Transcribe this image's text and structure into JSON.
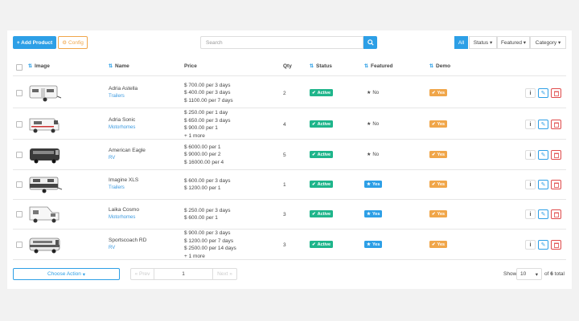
{
  "toolbar": {
    "add_product_label": "+ Add Product",
    "config_label": "Config",
    "search_placeholder": "Search",
    "filter_all": "All",
    "filter_status": "Status",
    "filter_featured": "Featured",
    "filter_category": "Category"
  },
  "columns": {
    "image": "Image",
    "name": "Name",
    "price": "Price",
    "qty": "Qty",
    "status": "Status",
    "featured": "Featured",
    "demo": "Demo"
  },
  "rows": [
    {
      "name": "Adria Astella",
      "category": "Trailers",
      "price": [
        "$ 700.00 per 3 days",
        "$ 400.00 per 3 days",
        "$ 1100.00 per 7 days"
      ],
      "qty": "2",
      "status": "Active",
      "featured": "No",
      "demo": "Yes",
      "thumb_kind": "trailer"
    },
    {
      "name": "Adria Sonic",
      "category": "Motorhomes",
      "price": [
        "$ 250.00 per 1 day",
        "$ 650.00 per 3 days",
        "$ 900.00 per 1",
        "+ 1 more"
      ],
      "qty": "4",
      "status": "Active",
      "featured": "No",
      "demo": "Yes",
      "thumb_kind": "motorhome"
    },
    {
      "name": "American Eagle",
      "category": "RV",
      "price": [
        "$ 6000.00 per 1",
        "$ 9000.00 per 2",
        "$ 16000.00 per 4"
      ],
      "qty": "5",
      "status": "Active",
      "featured": "No",
      "demo": "Yes",
      "thumb_kind": "bus"
    },
    {
      "name": "Imagine XLS",
      "category": "Trailers",
      "price": [
        "$ 600.00 per 3 days",
        "$ 1200.00 per 1"
      ],
      "qty": "1",
      "status": "Active",
      "featured": "Yes",
      "demo": "Yes",
      "thumb_kind": "trailer-dark"
    },
    {
      "name": "Laika Cosmo",
      "category": "Motorhomes",
      "price": [
        "$ 250.00 per 3 days",
        "$ 600.00 per 1"
      ],
      "qty": "3",
      "status": "Active",
      "featured": "Yes",
      "demo": "Yes",
      "thumb_kind": "camper"
    },
    {
      "name": "Sportscoach RD",
      "category": "RV",
      "price": [
        "$ 900.00 per 3 days",
        "$ 1200.00 per 7 days",
        "$ 2500.00 per 14 days",
        "+ 1 more"
      ],
      "qty": "3",
      "status": "Active",
      "featured": "Yes",
      "demo": "Yes",
      "thumb_kind": "bus-light"
    }
  ],
  "footer": {
    "choose_action": "Choose Action",
    "prev": "« Prev",
    "page": "1",
    "next": "Next »",
    "show_label": "Show",
    "per_page": "10",
    "of_label": "of",
    "total_pages": "6",
    "total_label": "total"
  },
  "colors": {
    "primary": "#2d9fe6",
    "active": "#1fb58b",
    "demo": "#f0a64a",
    "danger": "#e04a4a"
  },
  "icons": {
    "sort": "sort-icon",
    "star": "star-icon",
    "check": "check-icon",
    "info": "info-icon",
    "edit": "pencil-icon",
    "delete": "trash-icon",
    "search": "search-icon",
    "config": "gear-icon"
  }
}
